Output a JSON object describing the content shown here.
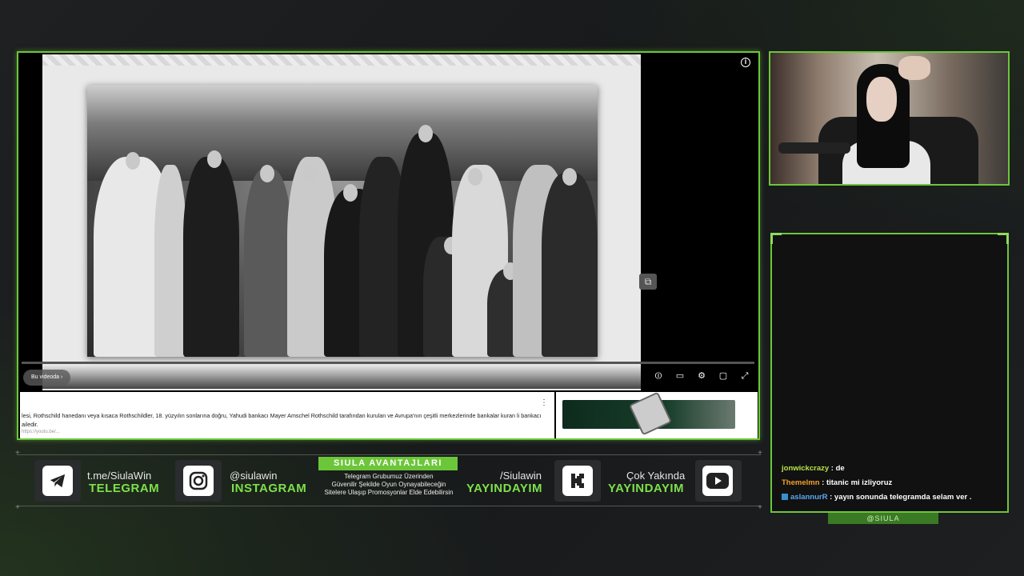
{
  "player": {
    "bu_videoda": "Bu videoda",
    "description": "lesi, Rothschild hanedanı veya kısaca Rothschildler, 18. yüzyılın sonlarına doğru, Yahudi bankacı Mayer Amschel Rothschild tarafından kurulan ve Avrupa'nın çeşitli merkezlerinde bankalar kuran li bankacı ailedir.",
    "description_link": "https://youtu.be/...",
    "icons": [
      "info-icon",
      "pip-icon",
      "autoplay-toggle-icon",
      "subtitles-icon",
      "settings-icon",
      "theater-icon",
      "fullscreen-icon"
    ]
  },
  "chat": {
    "messages": [
      {
        "user": "jonwickcrazy",
        "text": " : de"
      },
      {
        "user": "Themelmn",
        "text": " : titanic mi izliyoruz"
      },
      {
        "user": "aslannurR",
        "text": " : yayın sonunda telegramda selam ver ."
      }
    ],
    "handle_tag": "@SIULA"
  },
  "socials": {
    "telegram": {
      "top": "t.me/SiulaWin",
      "bottom": "TELEGRAM"
    },
    "instagram": {
      "top": "@siulawin",
      "bottom": "INSTAGRAM"
    },
    "kick": {
      "top": "/Siulawin",
      "bottom": "YAYINDAYIM"
    },
    "youtube": {
      "top": "Çok Yakında",
      "bottom": "YAYINDAYIM"
    }
  },
  "advantages": {
    "title": "SIULA AVANTAJLARI",
    "line1": "Telegram Grubumuz Üzerinden",
    "line2": "Güvenilir Şekilde Oyun Oynayabileceğin",
    "line3": "Sitelere Ulaşıp Promosyonlar Elde Edebilirsin"
  },
  "colors": {
    "accent": "#6cc63a",
    "bg": "#1b1d1f"
  }
}
